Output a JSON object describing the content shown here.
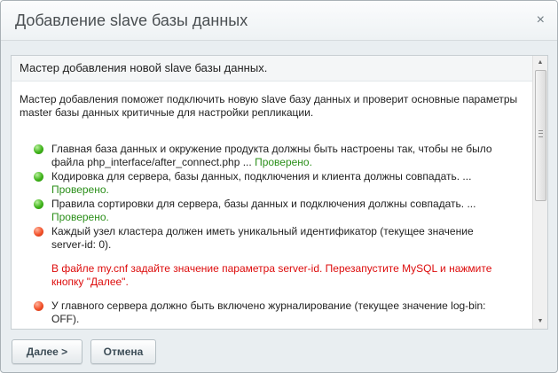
{
  "dialog": {
    "title": "Добавление slave базы данных",
    "close_glyph": "×"
  },
  "content": {
    "header": "Мастер добавления новой slave базы данных.",
    "intro": "Мастер добавления поможет подключить новую slave базу данных и проверит основные параметры master базы данных критичные для настройки репликации.",
    "items": [
      {
        "status": "ok",
        "text": "Главная база данных и окружение продукта должны быть настроены так, чтобы не было файла php_interface/after_connect.php ... ",
        "result": "Проверено."
      },
      {
        "status": "ok",
        "text": "Кодировка для сервера, базы данных, подключения и клиента должны совпадать. ... ",
        "result": "Проверено."
      },
      {
        "status": "ok",
        "text": "Правила сортировки для сервера, базы данных и подключения должны совпадать. ... ",
        "result": "Проверено."
      },
      {
        "status": "error",
        "text": "Каждый узел кластера должен иметь уникальный идентификатор (текущее значение server-id: 0).",
        "error": "В файле my.cnf задайте значение параметра server-id. Перезапустите MySQL и нажмите кнопку \"Далее\"."
      },
      {
        "status": "error",
        "text": "У главного сервера должно быть включено журналирование (текущее значение log-bin: OFF)."
      }
    ]
  },
  "buttons": {
    "next": "Далее >",
    "cancel": "Отмена"
  },
  "scrollbar": {
    "up_glyph": "▲",
    "down_glyph": "▼"
  },
  "colors": {
    "ok": "#2b8f1a",
    "error": "#dd0c0c",
    "dot_ok": "#3fb31a",
    "dot_error": "#f2512a"
  }
}
